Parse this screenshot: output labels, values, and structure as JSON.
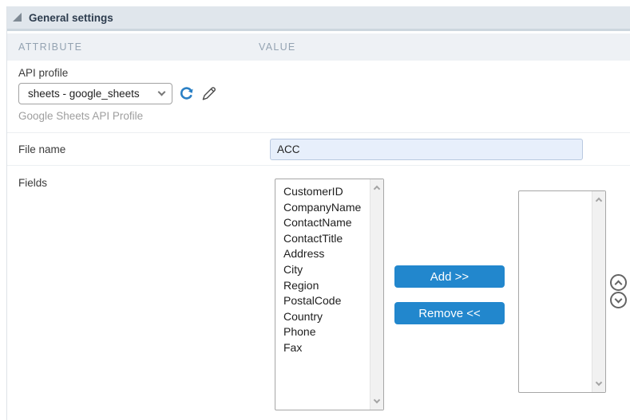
{
  "panel": {
    "title": "General settings",
    "columns": {
      "attribute": "ATTRIBUTE",
      "value": "VALUE"
    }
  },
  "rows": {
    "api_profile": {
      "label": "API profile",
      "select_value": "sheets - google_sheets",
      "hint": "Google Sheets API Profile",
      "icons": [
        "refresh-icon",
        "edit-pencil-icon"
      ]
    },
    "file_name": {
      "label": "File name",
      "value": "ACC"
    },
    "fields": {
      "label": "Fields",
      "available": [
        "CustomerID",
        "CompanyName",
        "ContactName",
        "ContactTitle",
        "Address",
        "City",
        "Region",
        "PostalCode",
        "Country",
        "Phone",
        "Fax"
      ],
      "selected": [],
      "add_label": "Add >>",
      "remove_label": "Remove <<"
    }
  },
  "colors": {
    "header_bg": "#e0e6ec",
    "header_border": "#ccd6de",
    "subheader_bg": "#eef1f5",
    "subheader_text": "#94a3b2",
    "button_blue": "#2287cd",
    "refresh_blue": "#2b80c5",
    "input_bg": "#e7effb",
    "hint_text": "#9e9e9e"
  }
}
